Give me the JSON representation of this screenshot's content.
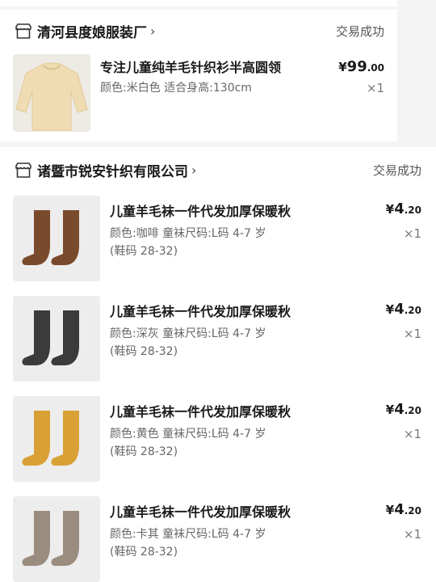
{
  "orders": [
    {
      "shop": "清河县度娘服装厂",
      "status": "交易成功",
      "items": [
        {
          "title": "专注儿童纯羊毛针织衫半高圆领",
          "spec": "颜色:米白色 适合身高:130cm",
          "currency": "¥",
          "price_int": "99",
          "price_dec": ".00",
          "qty": "×1"
        }
      ]
    },
    {
      "shop": "诸暨市锐安针织有限公司",
      "status": "交易成功",
      "items": [
        {
          "title": "儿童羊毛袜一件代发加厚保暖秋",
          "spec_line1": "颜色:咖啡 童袜尺码:L码 4-7 岁",
          "spec_line2": "(鞋码 28-32)",
          "currency": "¥",
          "price_int": "4",
          "price_dec": ".20",
          "qty": "×1",
          "color_hex": "#7a4a2c"
        },
        {
          "title": "儿童羊毛袜一件代发加厚保暖秋",
          "spec_line1": "颜色:深灰 童袜尺码:L码 4-7 岁",
          "spec_line2": "(鞋码 28-32)",
          "currency": "¥",
          "price_int": "4",
          "price_dec": ".20",
          "qty": "×1",
          "color_hex": "#3b3b3b"
        },
        {
          "title": "儿童羊毛袜一件代发加厚保暖秋",
          "spec_line1": "颜色:黄色 童袜尺码:L码 4-7 岁",
          "spec_line2": "(鞋码 28-32)",
          "currency": "¥",
          "price_int": "4",
          "price_dec": ".20",
          "qty": "×1",
          "color_hex": "#d9a036"
        },
        {
          "title": "儿童羊毛袜一件代发加厚保暖秋",
          "spec_line1": "颜色:卡其 童袜尺码:L码 4-7 岁",
          "spec_line2": "(鞋码 28-32)",
          "currency": "¥",
          "price_int": "4",
          "price_dec": ".20",
          "qty": "×1",
          "color_hex": "#9a8d80"
        }
      ]
    }
  ],
  "icons": {
    "shop": "store-icon",
    "chevron": "chevron-right-icon"
  },
  "colors": {
    "sweater": "#f0dcb2",
    "thumb_bg": "#ededed"
  }
}
